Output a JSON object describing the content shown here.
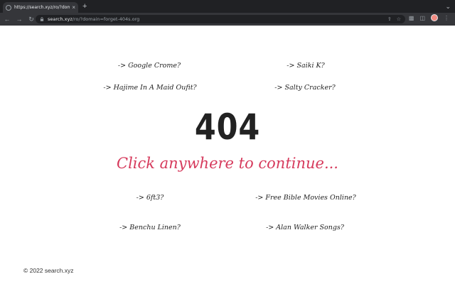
{
  "browser": {
    "tab_title": "https://search.xyz/ro/?domain=",
    "tab_close": "×",
    "new_tab": "+",
    "url_host": "search.xyz",
    "url_path": "/ro/?domain=forget-404s.org"
  },
  "links": [
    "-> Google Crome?",
    "-> Saiki K?",
    "-> Hajime In A Maid Oufit?",
    "-> Salty Cracker?",
    "-> 6ft3?",
    "-> Free Bible Movies Online?",
    "-> Benchu Linen?",
    "-> Alan Walker Songs?"
  ],
  "error_code": "404",
  "continue_text": "Click anywhere to continue...",
  "footer": "© 2022 search.xyz",
  "colors": {
    "accent": "#d63a5c",
    "chrome_dark": "#202124",
    "chrome_toolbar": "#35363a"
  }
}
